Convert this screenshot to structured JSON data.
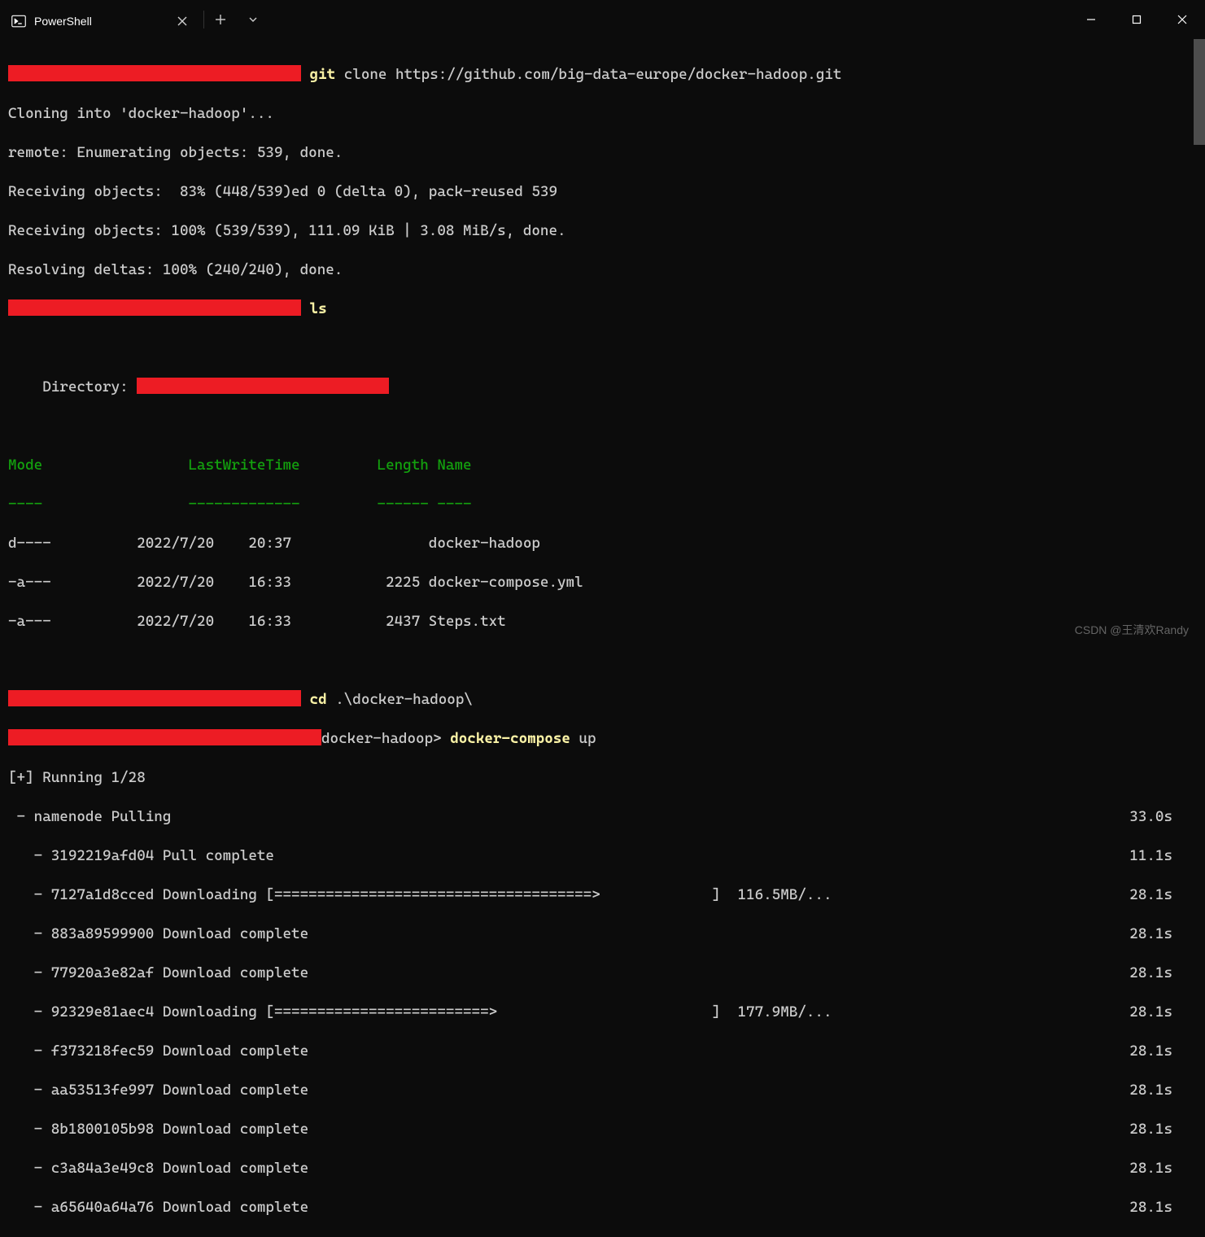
{
  "titlebar": {
    "tab_label": "PowerShell"
  },
  "term": {
    "cmd1": "git",
    "cmd1_args": "clone https://github.com/big-data-europe/docker-hadoop.git",
    "clone1": "Cloning into 'docker-hadoop'...",
    "clone2": "remote: Enumerating objects: 539, done.",
    "clone3": "Receiving objects:  83% (448/539)ed 0 (delta 0), pack-reused 539",
    "clone4": "Receiving objects: 100% (539/539), 111.09 KiB | 3.08 MiB/s, done.",
    "clone5": "Resolving deltas: 100% (240/240), done.",
    "cmd2": "ls",
    "dir_label": "Directory: ",
    "hdr_mode": "Mode",
    "hdr_lwt": "LastWriteTime",
    "hdr_len": "Length",
    "hdr_name": "Name",
    "sep_mode": "----",
    "sep_lwt": "-------------",
    "sep_len": "------",
    "sep_name": "----",
    "row1": "d----          2022/7/20    20:37                docker-hadoop",
    "row2": "-a---          2022/7/20    16:33           2225 docker-compose.yml",
    "row3": "-a---          2022/7/20    16:33           2437 Steps.txt",
    "cmd3": "cd",
    "cmd3_args": ".\\docker-hadoop\\",
    "prompt_suffix": "docker-hadoop> ",
    "cmd4": "docker-compose",
    "cmd4_args": "up",
    "run_hdr": "[+] Running 1/28",
    "pull_main": " - namenode Pulling",
    "pull_main_t": "33.0s",
    "l1": "   - 3192219afd04 Pull complete",
    "l1t": "11.1s",
    "l2": "   - 7127a1d8cced Downloading [=====================================>             ]  116.5MB/...",
    "l2t": "28.1s",
    "l3": "   - 883a89599900 Download complete",
    "l3t": "28.1s",
    "l4": "   - 77920a3e82af Download complete",
    "l4t": "28.1s",
    "l5": "   - 92329e81aec4 Downloading [=========================>                         ]  177.9MB/...",
    "l5t": "28.1s",
    "l6": "   - f373218fec59 Download complete",
    "l6t": "28.1s",
    "l7": "   - aa53513fe997 Download complete",
    "l7t": "28.1s",
    "l8": "   - 8b1800105b98 Download complete",
    "l8t": "28.1s",
    "l9": "   - c3a84a3e49c8 Download complete",
    "l9t": "28.1s",
    "l10": "   - a65640a64a76 Download complete",
    "l10t": "28.1s"
  },
  "watermark": "CSDN @王清欢Randy"
}
